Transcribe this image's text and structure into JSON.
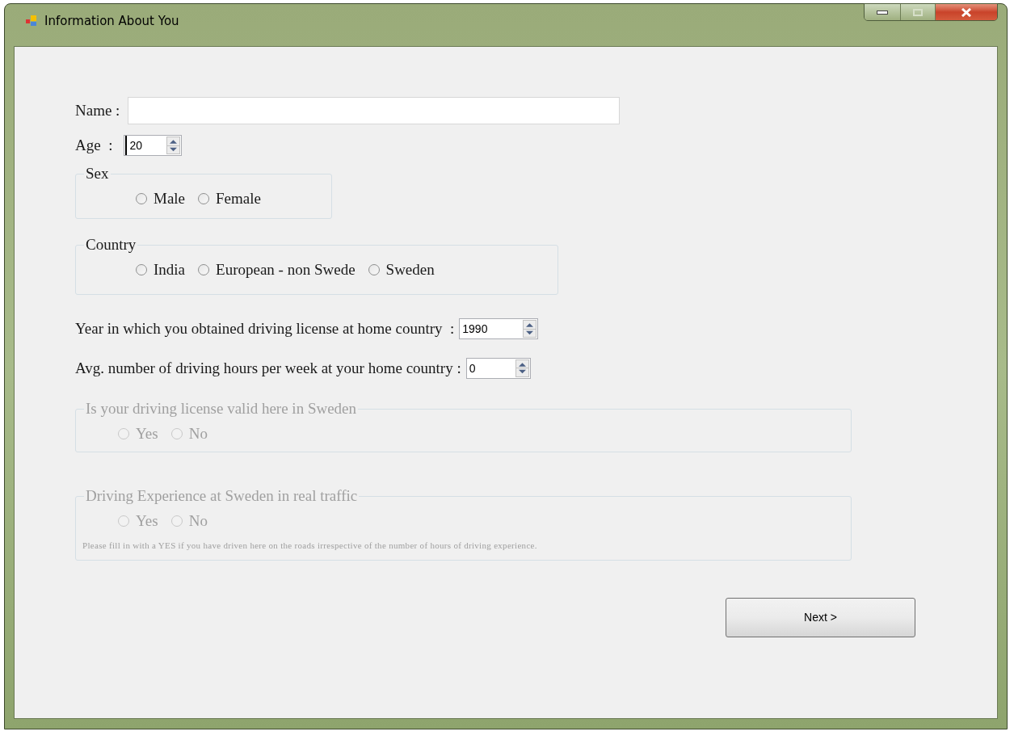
{
  "window": {
    "title": "Information About You"
  },
  "name_field": {
    "label": "Name :"
  },
  "age_field": {
    "label": "Age  :",
    "value": "20",
    "focused": true
  },
  "groups_top": [
    {
      "legend": "Sex",
      "disabled": false,
      "options": [
        {
          "label": "Male",
          "selected": false
        },
        {
          "label": "Female",
          "selected": false
        }
      ]
    },
    {
      "legend": "Country",
      "disabled": false,
      "options": [
        {
          "label": "India",
          "selected": false
        },
        {
          "label": "European - non Swede",
          "selected": false
        },
        {
          "label": "Sweden",
          "selected": false
        }
      ]
    }
  ],
  "spin_rows": [
    {
      "label": "Year in which you obtained driving license at home country  :",
      "value": "1990"
    },
    {
      "label": "Avg. number of driving hours per week at your home country :",
      "value": "0"
    }
  ],
  "groups_bottom": [
    {
      "legend": "Is your driving license valid here in Sweden",
      "disabled": true,
      "options": [
        {
          "label": "Yes",
          "selected": false
        },
        {
          "label": "No",
          "selected": false
        }
      ]
    },
    {
      "legend": "Driving Experience at Sweden in real traffic",
      "disabled": true,
      "options": [
        {
          "label": "Yes",
          "selected": false
        },
        {
          "label": "No",
          "selected": false
        }
      ],
      "note": "Please fill in with a YES if you have driven here on the roads irrespective of the number of hours of driving experience."
    }
  ],
  "next_button": {
    "label": "Next >"
  }
}
